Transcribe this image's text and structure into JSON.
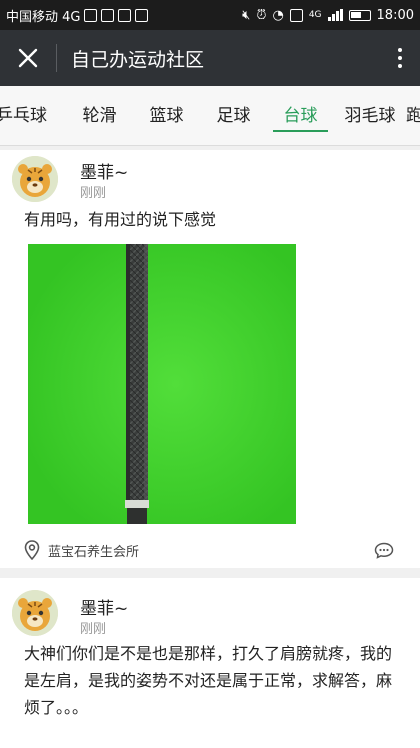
{
  "status_bar": {
    "carrier": "中国移动 4G",
    "network": "4G",
    "time": "18:00"
  },
  "app_bar": {
    "title": "自己办运动社区"
  },
  "tabs": [
    {
      "label": "乒乓球",
      "active": false
    },
    {
      "label": "轮滑",
      "active": false
    },
    {
      "label": "篮球",
      "active": false
    },
    {
      "label": "足球",
      "active": false
    },
    {
      "label": "台球",
      "active": true
    },
    {
      "label": "羽毛球",
      "active": false
    },
    {
      "label": "跑",
      "active": false
    }
  ],
  "posts": [
    {
      "author": "墨菲~",
      "time": "刚刚",
      "text": "有用吗，有用过的说下感觉",
      "location": "蓝宝石养生会所"
    },
    {
      "author": "墨菲~",
      "time": "刚刚",
      "text": "大神们你们是不是也是那样，打久了肩膀就疼，我的是左肩，是我的姿势不对还是属于正常，求解答，麻烦了。。。"
    }
  ],
  "colors": {
    "accent": "#2a9d5a",
    "header": "#2f3236",
    "image_bg": "#3fcf2e"
  }
}
